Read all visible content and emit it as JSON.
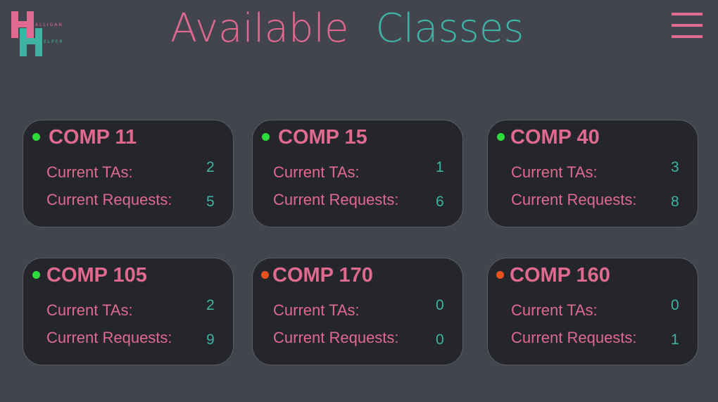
{
  "logo": {
    "line1": "ALLIGAN",
    "line2": "ELPER",
    "pink": "#e0698f",
    "teal": "#3eb3a3"
  },
  "header": {
    "title_word1": "Available",
    "title_word2": "Classes",
    "menu_icon": "hamburger-menu-icon"
  },
  "colors": {
    "background": "#42444e",
    "card": "#25262b",
    "pink": "#e0698f",
    "teal": "#3eb3a3",
    "active": "#2ddb3c",
    "inactive": "#e8521c"
  },
  "labels": {
    "current_tas": "Current TAs:",
    "current_requests": "Current Requests:"
  },
  "classes": [
    {
      "name": "COMP 11",
      "status": "active",
      "tas": "2",
      "requests": "5"
    },
    {
      "name": "COMP 15",
      "status": "active",
      "tas": "1",
      "requests": "6"
    },
    {
      "name": "COMP 40",
      "status": "active",
      "tas": "3",
      "requests": "8"
    },
    {
      "name": "COMP 105",
      "status": "active",
      "tas": "2",
      "requests": "9"
    },
    {
      "name": "COMP 170",
      "status": "inactive",
      "tas": "0",
      "requests": "0"
    },
    {
      "name": "COMP 160",
      "status": "inactive",
      "tas": "0",
      "requests": "1"
    }
  ]
}
